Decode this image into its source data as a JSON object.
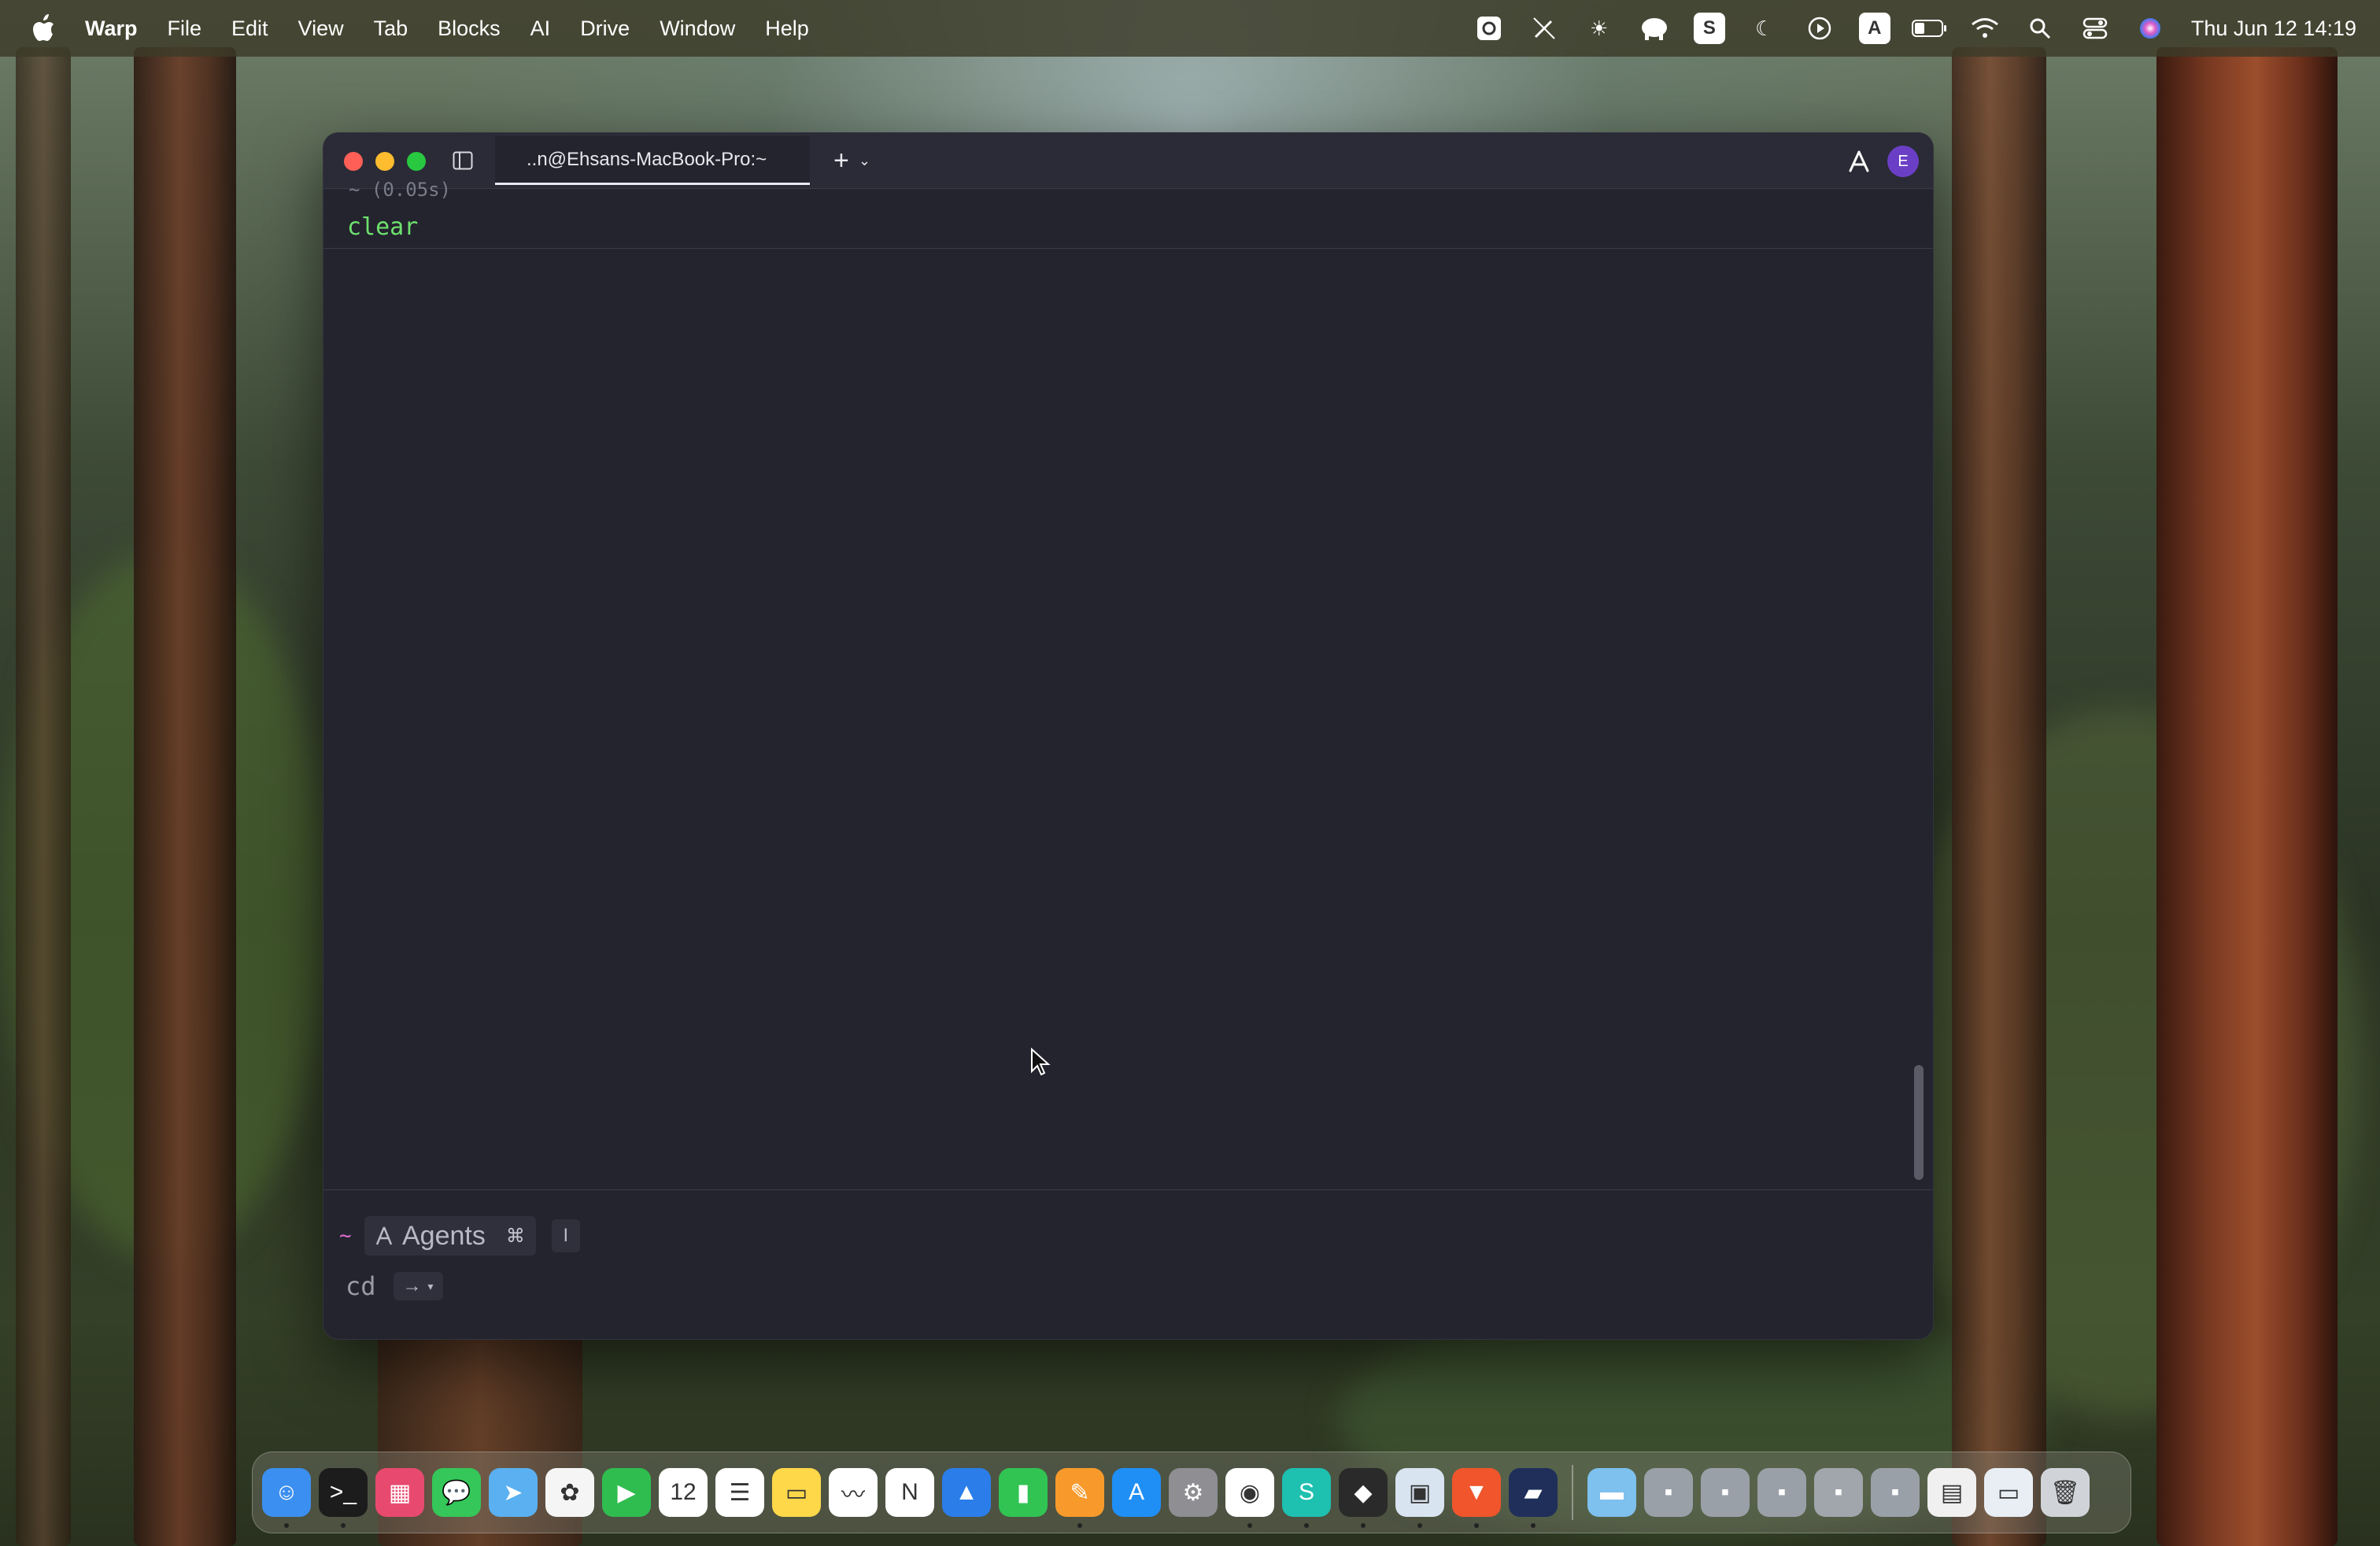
{
  "menubar": {
    "app_name": "Warp",
    "items": [
      "File",
      "Edit",
      "View",
      "Tab",
      "Blocks",
      "AI",
      "Drive",
      "Window",
      "Help"
    ],
    "status_icons": [
      "camera-icon",
      "no-pen-icon",
      "brightness-icon",
      "elephant-icon",
      "s-box-icon",
      "moon-icon",
      "play-icon",
      "a-box-icon",
      "battery-icon",
      "wifi-icon",
      "search-icon",
      "control-center-icon",
      "siri-icon"
    ],
    "s_box_letter": "S",
    "a_box_letter": "A",
    "clock": "Thu Jun 12  14:19"
  },
  "window": {
    "tab_title": "..n@Ehsans-MacBook-Pro:~",
    "new_tab_symbol": "+",
    "avatar_initial": "E",
    "block": {
      "header": "~ (0.05s)",
      "command": "clear"
    },
    "prompt": {
      "cwd": "~",
      "agents_label": "Agents",
      "agents_shortcut": "⌘",
      "cursor_symbol": "I",
      "suggested_command": "cd",
      "arrow_symbol": "→"
    }
  },
  "dock": {
    "apps": [
      {
        "name": "Finder",
        "icon": "finder-icon",
        "color": "#3b8ff0",
        "glyph": "☺",
        "running": true
      },
      {
        "name": "Terminal",
        "icon": "terminal-icon",
        "color": "#1c1c1c",
        "glyph": ">_",
        "running": true
      },
      {
        "name": "Launchpad",
        "icon": "launchpad-icon",
        "color": "#e84a6f",
        "glyph": "▦",
        "running": false
      },
      {
        "name": "Messages",
        "icon": "messages-icon",
        "color": "#35c759",
        "glyph": "💬",
        "running": false
      },
      {
        "name": "Maps",
        "icon": "maps-icon",
        "color": "#5ab0f0",
        "glyph": "➤",
        "running": false
      },
      {
        "name": "Photos",
        "icon": "photos-icon",
        "color": "#f5f5f5",
        "glyph": "✿",
        "running": false
      },
      {
        "name": "FaceTime",
        "icon": "facetime-icon",
        "color": "#2fbd4f",
        "glyph": "▶",
        "running": false
      },
      {
        "name": "Calendar",
        "icon": "calendar-icon",
        "color": "#ffffff",
        "glyph": "12",
        "running": false
      },
      {
        "name": "Reminders",
        "icon": "reminders-icon",
        "color": "#ffffff",
        "glyph": "☰",
        "running": false
      },
      {
        "name": "Notes",
        "icon": "notes-icon",
        "color": "#ffd84a",
        "glyph": "▭",
        "running": false
      },
      {
        "name": "Freeform",
        "icon": "freeform-icon",
        "color": "#ffffff",
        "glyph": "〰",
        "running": false
      },
      {
        "name": "Notion",
        "icon": "notion-icon",
        "color": "#ffffff",
        "glyph": "N",
        "running": false
      },
      {
        "name": "Keynote",
        "icon": "keynote-icon",
        "color": "#2b7de9",
        "glyph": "▲",
        "running": false
      },
      {
        "name": "Numbers",
        "icon": "numbers-icon",
        "color": "#31c453",
        "glyph": "▮",
        "running": false
      },
      {
        "name": "Pages",
        "icon": "pages-icon",
        "color": "#f79a2b",
        "glyph": "✎",
        "running": true
      },
      {
        "name": "App Store",
        "icon": "app-store-icon",
        "color": "#1f8ff5",
        "glyph": "A",
        "running": false
      },
      {
        "name": "System Settings",
        "icon": "settings-icon",
        "color": "#8e8e93",
        "glyph": "⚙",
        "running": false
      },
      {
        "name": "Chrome",
        "icon": "chrome-icon",
        "color": "#ffffff",
        "glyph": "◉",
        "running": true
      },
      {
        "name": "Surfshark",
        "icon": "surfshark-icon",
        "color": "#1ec0b0",
        "glyph": "S",
        "running": true
      },
      {
        "name": "Cube",
        "icon": "cube-icon",
        "color": "#2a2a2a",
        "glyph": "◆",
        "running": true
      },
      {
        "name": "Preview",
        "icon": "preview-icon",
        "color": "#d8e4f0",
        "glyph": "▣",
        "running": true
      },
      {
        "name": "Brave",
        "icon": "brave-icon",
        "color": "#f0552b",
        "glyph": "▼",
        "running": true
      },
      {
        "name": "Warp",
        "icon": "warp-icon",
        "color": "#1f2f5a",
        "glyph": "▰",
        "running": true
      }
    ],
    "minimized": [
      {
        "icon": "downloads-folder-icon",
        "color": "#7ec0ee",
        "glyph": "▬"
      },
      {
        "icon": "minimized-window-icon",
        "color": "#9aa0a8",
        "glyph": "▪"
      },
      {
        "icon": "minimized-window-icon",
        "color": "#9aa0a8",
        "glyph": "▪"
      },
      {
        "icon": "minimized-window-icon",
        "color": "#9aa0a8",
        "glyph": "▪"
      },
      {
        "icon": "minimized-pages-icon",
        "color": "#a0a6ac",
        "glyph": "▪"
      },
      {
        "icon": "minimized-window-icon",
        "color": "#9aa0a8",
        "glyph": "▪"
      },
      {
        "icon": "minimized-document-icon",
        "color": "#f0f0f0",
        "glyph": "▤"
      },
      {
        "icon": "minimized-screenshot-icon",
        "color": "#e8eef4",
        "glyph": "▭"
      },
      {
        "icon": "trash-icon",
        "color": "#d0d4d8",
        "glyph": "🗑"
      }
    ]
  }
}
